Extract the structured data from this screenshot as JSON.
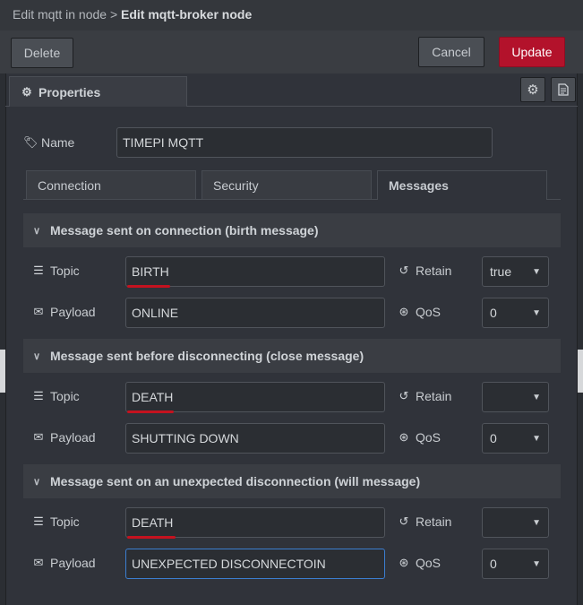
{
  "header": {
    "breadcrumb_parent": "Edit mqtt in node",
    "breadcrumb_separator": ">",
    "breadcrumb_current": "Edit mqtt-broker node"
  },
  "toolbar": {
    "delete_label": "Delete",
    "cancel_label": "Cancel",
    "update_label": "Update"
  },
  "props_tab": {
    "label": "Properties"
  },
  "name_field": {
    "label": "Name",
    "value": "TIMEPI MQTT"
  },
  "tabs": [
    {
      "label": "Connection",
      "active": false
    },
    {
      "label": "Security",
      "active": false
    },
    {
      "label": "Messages",
      "active": true
    }
  ],
  "labels": {
    "topic": "Topic",
    "payload": "Payload",
    "retain": "Retain",
    "qos": "QoS"
  },
  "sections": [
    {
      "title": "Message sent on connection (birth message)",
      "topic": "BIRTH",
      "payload": "ONLINE",
      "retain": "true",
      "qos": "0"
    },
    {
      "title": "Message sent before disconnecting (close message)",
      "topic": "DEATH",
      "payload": "SHUTTING DOWN",
      "retain": "",
      "qos": "0"
    },
    {
      "title": "Message sent on an unexpected disconnection (will message)",
      "topic": "DEATH",
      "payload": "UNEXPECTED DISCONNECTOIN",
      "retain": "",
      "qos": "0"
    }
  ],
  "colors": {
    "update_button": "#b3122b",
    "spellcheck_underline": "#c4121f",
    "focus_border": "#3b7ed0"
  }
}
